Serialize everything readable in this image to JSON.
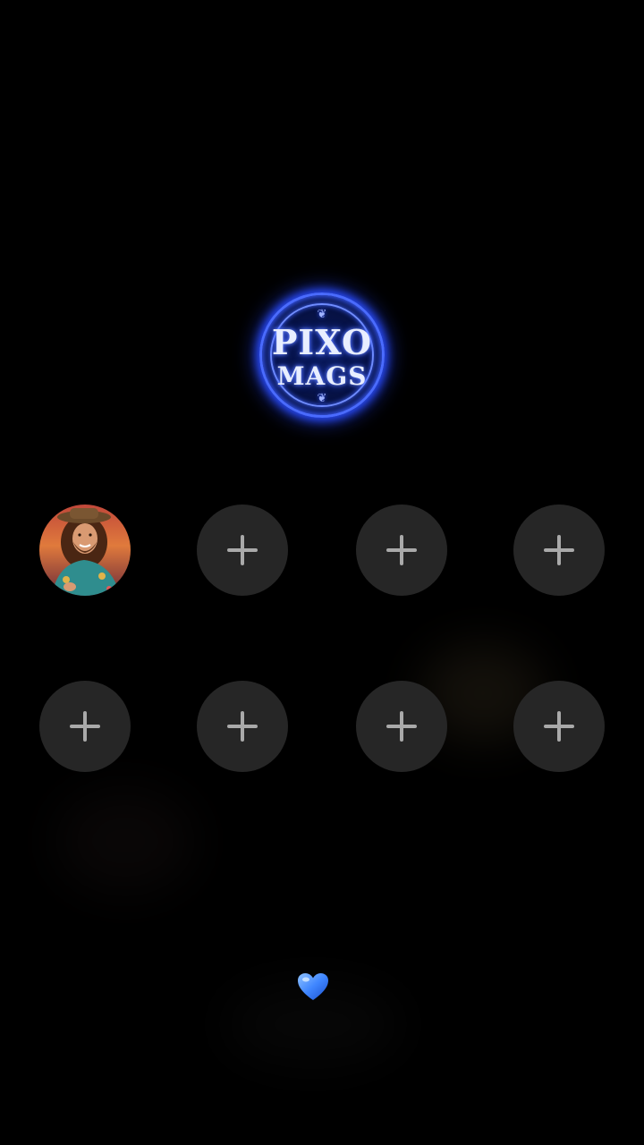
{
  "logo": {
    "line1": "PIXO",
    "line2": "MAGS",
    "glow_color": "#2a4dff"
  },
  "grid": {
    "rows": [
      [
        {
          "type": "avatar",
          "icon": "user-avatar"
        },
        {
          "type": "add",
          "icon": "plus-icon"
        },
        {
          "type": "add",
          "icon": "plus-icon"
        },
        {
          "type": "add",
          "icon": "plus-icon"
        }
      ],
      [
        {
          "type": "add",
          "icon": "plus-icon"
        },
        {
          "type": "add",
          "icon": "plus-icon"
        },
        {
          "type": "add",
          "icon": "plus-icon"
        },
        {
          "type": "add",
          "icon": "plus-icon"
        }
      ]
    ],
    "slot_color": "#262626",
    "plus_color": "#a9a9a9"
  },
  "bottom": {
    "icon": "blue-heart-icon",
    "color": "#3f86ff"
  }
}
